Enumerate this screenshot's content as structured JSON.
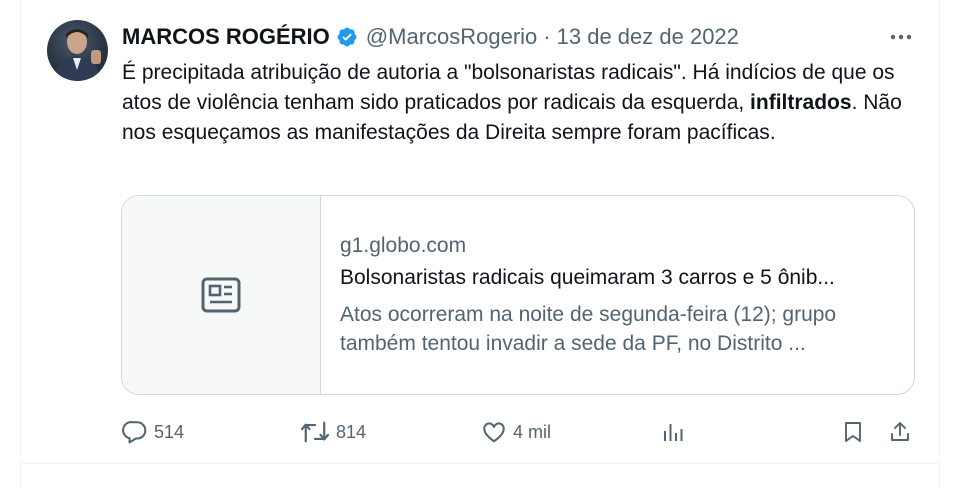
{
  "tweet": {
    "author_name": "MARCOS ROGÉRIO",
    "handle": "@MarcosRogerio",
    "separator": "·",
    "date": "13 de dez de 2022",
    "text_part1": "É precipitada atribuição de autoria a \"bolsonaristas radicais\". Há indícios de que os atos de violência tenham sido praticados por radicais da esquerda, ",
    "text_bold": "infiltrados",
    "text_part2": ". Não nos esqueçamos as manifestações da Direita sempre foram pacíficas."
  },
  "card": {
    "domain": "g1.globo.com",
    "title": "Bolsonaristas radicais queimaram 3 carros e 5 ônib...",
    "description": "Atos ocorreram na noite de segunda-feira (12); grupo também tentou invadir a sede da PF, no Distrito ...",
    "icon": "news-article-icon"
  },
  "actions": {
    "replies": "514",
    "reposts": "814",
    "likes": "4 mil"
  },
  "colors": {
    "text_primary": "#0f1419",
    "text_secondary": "#536471",
    "verified": "#1d9bf0",
    "border": "#cfd9de"
  }
}
